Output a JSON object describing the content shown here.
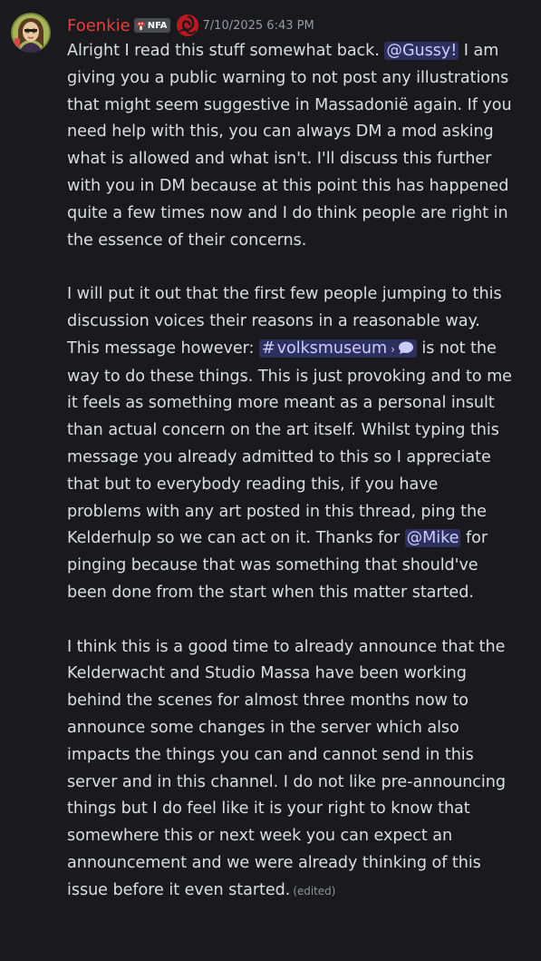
{
  "message": {
    "author": {
      "username": "Foenkie",
      "tag": "NFA",
      "role_icon": "red-flower-icon",
      "avatar": "avatar-image",
      "name_color": "#e63f3f"
    },
    "timestamp": "7/10/2025 6:43 PM",
    "paragraph1": {
      "t1": "Alright I read this stuff somewhat back. ",
      "mention": "@Gussy!",
      "t2": " I am giving you a public warning to not post any illustrations that might seem suggestive in Massadonië again. If you need help with this, you can always DM a mod asking what is allowed and what isn't. I'll discuss this further with you in DM because at this point this has happened quite a few times now and I do think people are right in the essence of their concerns."
    },
    "paragraph2": {
      "t1": "I will put it out that the first few people jumping to this discussion voices their reasons in a reasonable way. This message however: ",
      "channel_hash": "#",
      "channel_name": "volksmuseum",
      "channel_chevron": "›",
      "t2": " is not the way to do these things. This is just provoking and to me it feels as something more meant as a personal insult than actual concern on the art itself. Whilst typing this message you already admitted to this so I appreciate that but to everybody reading this, if you have problems with any art posted in this thread, ping the Kelderhulp so we can act on it. Thanks for ",
      "mention": "@Mike",
      "t3": " for pinging because that was something that should've been done from the start when this matter started."
    },
    "paragraph3": {
      "t1": "I think this is a good time to already announce that the Kelderwacht and Studio Massa have been working behind the scenes for almost three months now to announce some changes in the server which also impacts the things you can and cannot send in this server and in this channel. I do not like pre-announcing things but I do feel like it is your right to know that somewhere this or next week you can expect an announcement and we were already thinking of this issue before it even started.",
      "edited": "(edited)"
    }
  },
  "colors": {
    "background": "#1a1a1e",
    "text": "#dbdee1",
    "mention_bg": "rgba(88, 101, 242, 0.3)",
    "mention_text": "#c9cdfb",
    "timestamp": "#949ba4"
  }
}
